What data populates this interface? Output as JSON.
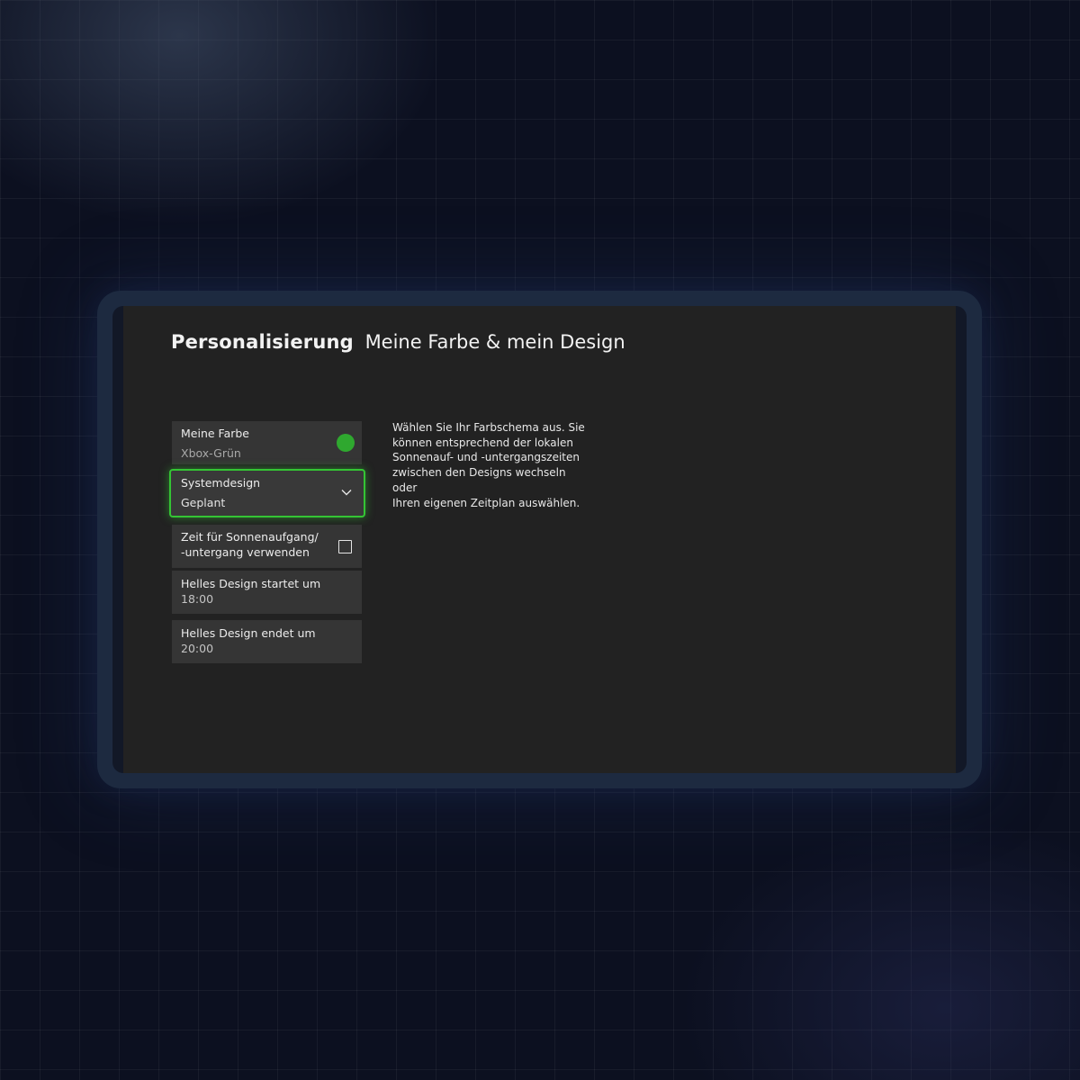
{
  "header": {
    "section": "Personalisierung",
    "page": "Meine Farbe & mein Design"
  },
  "settings": {
    "my_color": {
      "label": "Meine Farbe",
      "value": "Xbox-Grün",
      "swatch_color": "#2fa82f"
    },
    "system_design": {
      "label": "Systemdesign",
      "value": "Geplant",
      "icon": "chevron-down-icon"
    },
    "sunrise_sunset": {
      "label_line1": "Zeit für Sonnenaufgang/",
      "label_line2": "-untergang verwenden",
      "checked": false
    },
    "light_start": {
      "label": "Helles Design startet um",
      "value": "18:00"
    },
    "light_end": {
      "label": "Helles Design endet um",
      "value": "20:00"
    }
  },
  "description": {
    "lines": [
      "Wählen Sie Ihr Farbschema aus. Sie",
      "können entsprechend der lokalen",
      "Sonnenauf- und -untergangszeiten",
      "zwischen den Designs wechseln oder",
      "Ihren eigenen Zeitplan auswählen."
    ]
  },
  "colors": {
    "accent": "#34c534",
    "screen_background": "#222222",
    "tile_background": "#353535"
  }
}
